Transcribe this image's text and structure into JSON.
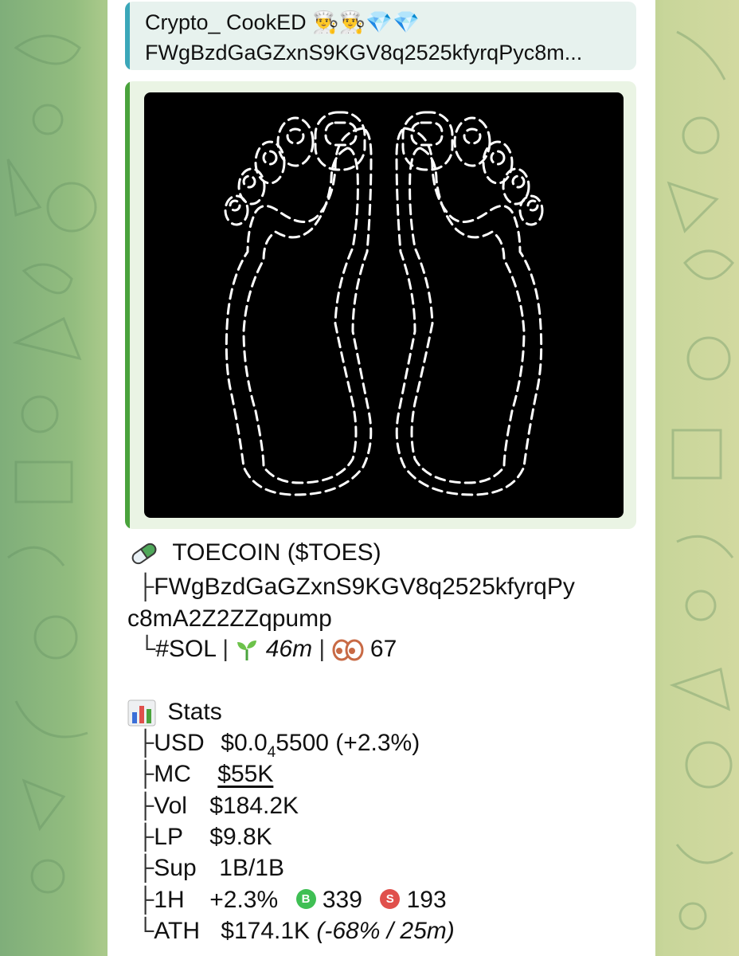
{
  "reply": {
    "title": "Crypto_ CookED",
    "emojis": "👨‍🍳👨‍🍳💎💎",
    "preview": "FWgBzdGaGZxnS9KGV8q2525kfyrqPyc8m..."
  },
  "media": {
    "description_icon": "feet-outline-image"
  },
  "token": {
    "icon": "pill-icon",
    "name_line": "TOECOIN ($TOES)",
    "tree_mid": "├",
    "tree_end": "└",
    "address_line1": "FWgBzdGaGZxnS9KGV8q2525kfyrqPy",
    "address_line2": "c8mA2Z2ZZqpump",
    "chain": "#SOL",
    "sep": "|",
    "age": "46m",
    "eyes": "67"
  },
  "stats": {
    "title": "Stats",
    "usd_label": "USD",
    "usd_prefix": "$0.0",
    "usd_sub": "4",
    "usd_rest": "5500 (+2.3%)",
    "mc_label": "MC",
    "mc_value": "$55K",
    "vol_label": "Vol",
    "vol_value": "$184.2K",
    "lp_label": "LP",
    "lp_value": "$9.8K",
    "sup_label": "Sup",
    "sup_value": "1B/1B",
    "h1_label": "1H",
    "h1_change": "+2.3%",
    "buy_badge": "B",
    "buy_count": "339",
    "sell_badge": "S",
    "sell_count": "193",
    "ath_label": "ATH",
    "ath_value": "$174.1K",
    "ath_detail": "(-68% / 25m)"
  },
  "colors": {
    "reply_accent": "#3ba7b9",
    "media_accent": "#4aa33c",
    "buy": "#3fbf54",
    "sell": "#e0504c"
  }
}
